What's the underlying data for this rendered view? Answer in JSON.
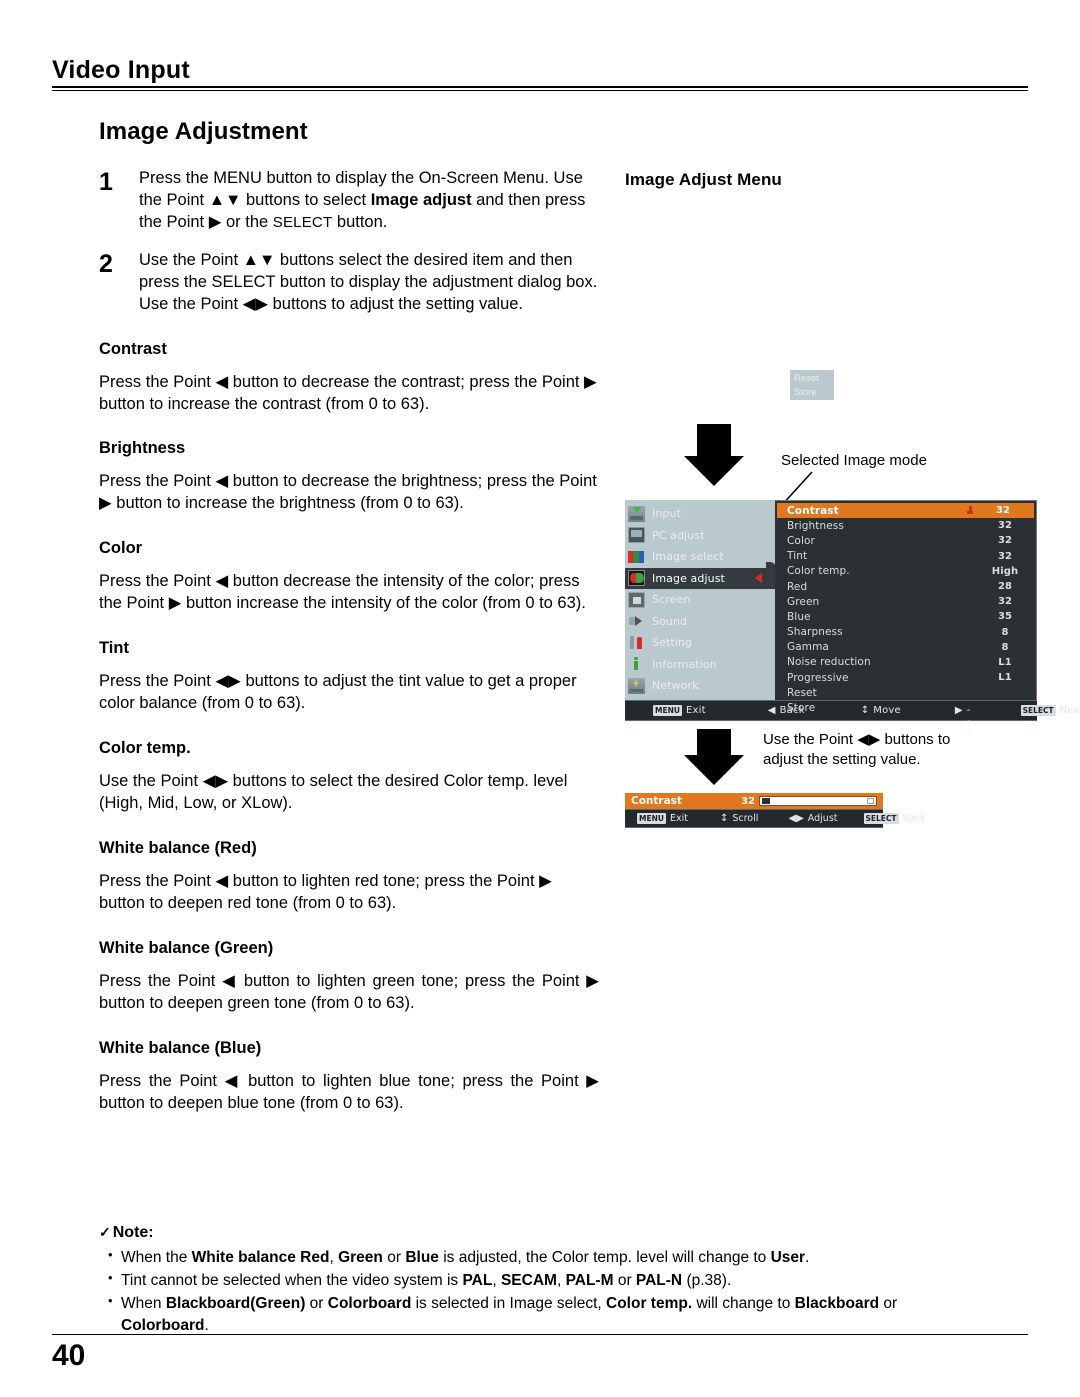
{
  "running_head": {
    "title": "Video Input"
  },
  "section": {
    "title": "Image Adjustment"
  },
  "steps": [
    {
      "num": "1",
      "seg1": "Press the MENU button to display the On-Screen Menu. Use the Point ▲▼ buttons to select ",
      "bold1": "Image adjust",
      "seg2": " and then press the Point ▶ or the ",
      "smallcap": "SELECT",
      "seg3": " button."
    },
    {
      "num": "2",
      "text": "Use the Point ▲▼ buttons select the desired item and then press the SELECT button to display the adjustment dialog box. Use the Point ◀▶ buttons to adjust the setting value."
    }
  ],
  "topics": [
    {
      "head": "Contrast",
      "body": "Press the Point ◀ button to decrease the contrast; press the Point ▶ button to increase the contrast (from 0 to 63).",
      "justify": false
    },
    {
      "head": "Brightness",
      "body": "Press the Point ◀ button to decrease the brightness; press the Point ▶ button to increase the brightness (from 0 to 63).",
      "justify": false
    },
    {
      "head": "Color",
      "body": "Press the Point ◀ button decrease the intensity of the color; press the Point ▶ button increase the intensity of the color (from 0 to 63).",
      "justify": false
    },
    {
      "head": "Tint",
      "body": "Press the Point ◀▶ buttons to adjust the tint value to get a proper color balance (from 0 to 63).",
      "justify": false
    },
    {
      "head": "Color temp.",
      "body": "Use the Point ◀▶ buttons to select the desired Color temp. level (High, Mid, Low, or XLow).",
      "justify": false
    },
    {
      "head": "White balance (Red)",
      "body": "Press the Point ◀ button to lighten red tone; press the Point ▶ button to deepen red tone (from 0 to 63).",
      "justify": false
    },
    {
      "head": "White balance (Green)",
      "body": "Press the Point ◀ button to lighten green tone; press the Point ▶ button to deepen green tone (from 0 to 63).",
      "justify": true
    },
    {
      "head": "White balance (Blue)",
      "body": "Press the Point ◀ button to lighten blue tone; press the Point ▶ button to deepen blue tone (from 0 to 63).",
      "justify": true
    }
  ],
  "note": {
    "check": "✓",
    "head": "Note:",
    "items": [
      {
        "p1": "When the ",
        "b1": "White balance Red",
        "p2": ", ",
        "b2": "Green",
        "p3": " or ",
        "b3": "Blue",
        "p4": " is adjusted, the Color temp. level will change to ",
        "b4": "User",
        "p5": "."
      },
      {
        "p1": "Tint cannot be selected when the video system is ",
        "b1": "PAL",
        "p2": ", ",
        "b2": "SECAM",
        "p3": ", ",
        "b3": "PAL-M",
        "p4": " or ",
        "b4": "PAL-N",
        "p5": " (p.38)."
      },
      {
        "p1": "When ",
        "b1": "Blackboard(Green)",
        "p2": " or ",
        "b2": "Colorboard",
        "p3": " is selected in Image select, ",
        "b3": "Color temp.",
        "p4": " will change to ",
        "b4": "Blackboard",
        "p5": " or ",
        "b5": "Colorboard",
        "p6": "."
      }
    ]
  },
  "panel": {
    "title": "Image Adjust Menu"
  },
  "reset_store_box": {
    "line1": "Reset",
    "line2": "Store"
  },
  "callouts": {
    "selected_image_mode": "Selected Image mode",
    "adjust": "Use the Point ◀▶ buttons to adjust the setting value."
  },
  "osd": {
    "sidebar": [
      {
        "label": "Input",
        "icon": "input-icon",
        "active": false
      },
      {
        "label": "PC adjust",
        "icon": "pc-adjust-icon",
        "active": false
      },
      {
        "label": "Image select",
        "icon": "image-select-icon",
        "active": false
      },
      {
        "label": "Image adjust",
        "icon": "image-adjust-icon",
        "active": true
      },
      {
        "label": "Screen",
        "icon": "screen-icon",
        "active": false
      },
      {
        "label": "Sound",
        "icon": "sound-icon",
        "active": false
      },
      {
        "label": "Setting",
        "icon": "setting-icon",
        "active": false
      },
      {
        "label": "Information",
        "icon": "information-icon",
        "active": false
      },
      {
        "label": "Network",
        "icon": "network-icon",
        "active": false
      }
    ],
    "items": [
      {
        "name": "Contrast",
        "value": "32",
        "highlight": true
      },
      {
        "name": "Brightness",
        "value": "32",
        "highlight": false
      },
      {
        "name": "Color",
        "value": "32",
        "highlight": false
      },
      {
        "name": "Tint",
        "value": "32",
        "highlight": false
      },
      {
        "name": "Color temp.",
        "value": "High",
        "highlight": false
      },
      {
        "name": "Red",
        "value": "28",
        "highlight": false
      },
      {
        "name": "Green",
        "value": "32",
        "highlight": false
      },
      {
        "name": "Blue",
        "value": "35",
        "highlight": false
      },
      {
        "name": "Sharpness",
        "value": "8",
        "highlight": false
      },
      {
        "name": "Gamma",
        "value": "8",
        "highlight": false
      },
      {
        "name": "Noise reduction",
        "value": "L1",
        "highlight": false
      },
      {
        "name": "Progressive",
        "value": "L1",
        "highlight": false
      },
      {
        "name": "Reset",
        "value": "",
        "highlight": false
      },
      {
        "name": "Store",
        "value": "",
        "highlight": false
      }
    ],
    "helpbar": {
      "exit_key": "MENU",
      "exit_label": "Exit",
      "back_glyph": "◀",
      "back_label": "Back",
      "move_glyph": "↕",
      "move_label": "Move",
      "dash_glyph": "▶",
      "dash_label": "- - - - -",
      "next_key": "SELECT",
      "next_label": "Next"
    }
  },
  "contrast_dialog": {
    "name": "Contrast",
    "value": "32",
    "helpbar": {
      "exit_key": "MENU",
      "exit_label": "Exit",
      "scroll_glyph": "↕",
      "scroll_label": "Scroll",
      "adjust_glyph": "◀▶",
      "adjust_label": "Adjust",
      "back_key": "SELECT",
      "back_label": "Back"
    }
  },
  "footer": {
    "page_number": "40"
  },
  "colors": {
    "osd_highlight": "#e07820",
    "osd_list_bg": "#2b3034",
    "osd_sidebar_bg": "#b9c9cd",
    "osd_helpbar_bg": "#232a2e",
    "red_marker": "#cf2b1e"
  }
}
